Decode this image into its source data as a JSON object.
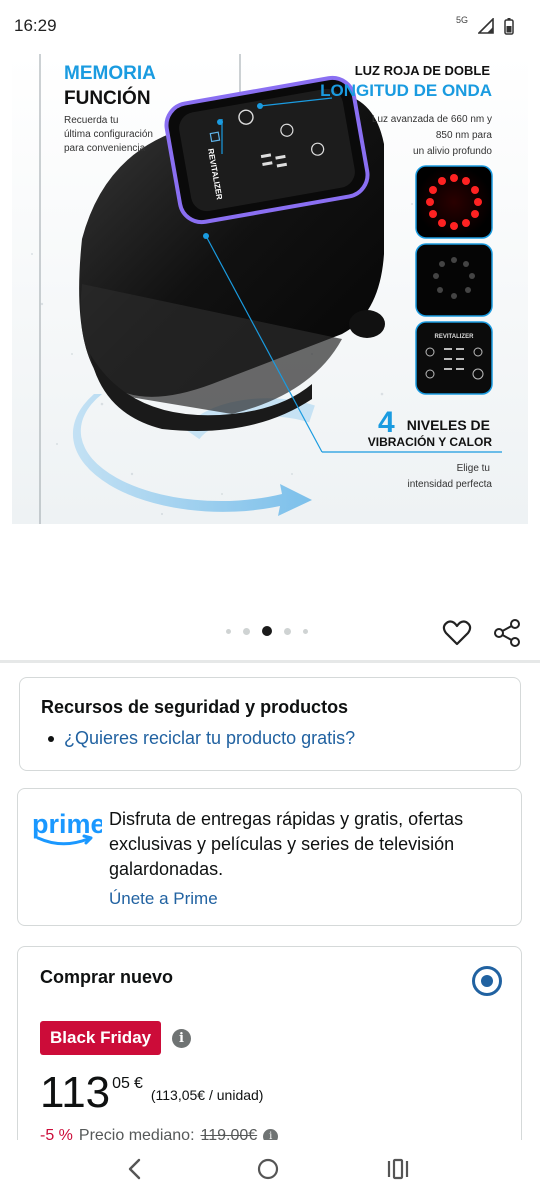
{
  "status_bar": {
    "time": "16:29",
    "network": "5G"
  },
  "product_image": {
    "memory_title_line1": "MEMORIA",
    "memory_title_line2": "FUNCIÓN",
    "memory_desc_line1": "Recuerda tu",
    "memory_desc_line2": "última configuración",
    "memory_desc_line3": "para conveniencia",
    "light_title_line1": "LUZ ROJA DE DOBLE",
    "light_title_line2": "LONGITUD DE ONDA",
    "light_desc_line1": "Luz avanzada de 660 nm y",
    "light_desc_line2": "850 nm para",
    "light_desc_line3": "un alivio profundo",
    "levels_number": "4",
    "levels_title_line1": "NIVELES DE",
    "levels_title_line2": "VIBRACIÓN Y CALOR",
    "levels_desc_line1": "Elige tu",
    "levels_desc_line2": "intensidad perfecta",
    "brand_on_device": "REVITALIZER",
    "brand_on_thumb": "REVITALIZER"
  },
  "gallery": {
    "dot_count": 5,
    "active_index": 2
  },
  "safety": {
    "title": "Recursos de seguridad y productos",
    "link": "¿Quieres reciclar tu producto gratis?"
  },
  "prime": {
    "logo_text": "prime",
    "text": "Disfruta de entregas rápidas y gratis, ofertas exclusivas y películas y series de televisión galardonadas.",
    "join_link": "Únete a Prime"
  },
  "buy": {
    "title": "Comprar nuevo",
    "badge": "Black Friday",
    "price_whole": "113",
    "price_fraction": "05",
    "currency": "€",
    "unit_price": "(113,05€ / unidad)",
    "discount": "-5 %",
    "median_label": "Precio mediano:",
    "median_price": "119,00€"
  },
  "colors": {
    "link": "#2162a1",
    "badge": "#cc0c39",
    "accent_blue": "#1a9be0"
  }
}
